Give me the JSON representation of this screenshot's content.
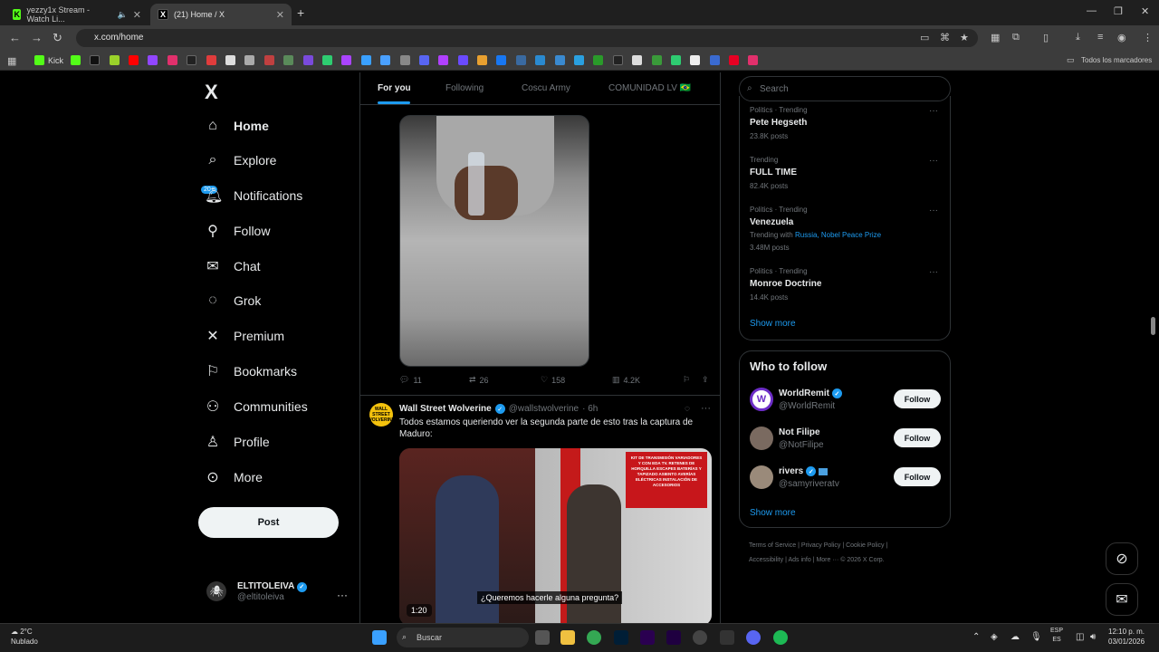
{
  "browser": {
    "tabs": [
      {
        "title": "yezzy1x Stream - Watch Li...",
        "favicon": "K",
        "favicon_color": "#53fc18"
      },
      {
        "title": "(21) Home / X",
        "favicon": "X",
        "favicon_color": "#000000"
      }
    ],
    "url": "x.com/home",
    "bookmark_label": "Kick",
    "all_bookmarks": "Todos los marcadores"
  },
  "nav": {
    "logo": "X",
    "items": [
      {
        "label": "Home",
        "icon": "home-icon"
      },
      {
        "label": "Explore",
        "icon": "search-icon"
      },
      {
        "label": "Notifications",
        "icon": "bell-icon"
      },
      {
        "label": "Follow",
        "icon": "person-plus-icon"
      },
      {
        "label": "Chat",
        "icon": "mail-icon"
      },
      {
        "label": "Grok",
        "icon": "grok-icon"
      },
      {
        "label": "Premium",
        "icon": "x-icon"
      },
      {
        "label": "Bookmarks",
        "icon": "bookmark-icon"
      },
      {
        "label": "Communities",
        "icon": "people-icon"
      },
      {
        "label": "Profile",
        "icon": "person-icon"
      },
      {
        "label": "More",
        "icon": "more-circle-icon"
      }
    ],
    "notif_badge": "20+",
    "post_label": "Post",
    "profile_name": "ELTITOLEIVA",
    "profile_handle": "@eltitoleiva"
  },
  "feed": {
    "tabs": [
      "For you",
      "Following",
      "Coscu Army",
      "COMUNIDAD LV 🇧🇷"
    ],
    "tweet1_actions": {
      "replies": "11",
      "reposts": "26",
      "likes": "158",
      "views": "4.2K"
    },
    "tweet2": {
      "name": "Wall Street Wolverine",
      "handle": "@wallstwolverine",
      "time": "· 6h",
      "text": "Todos estamos queriendo ver la segunda parte de esto tras la captura de Maduro:",
      "video_duration": "1:20",
      "subtitle": "¿Queremos hacerle alguna pregunta?",
      "sign_text": "KIT DE TRANSMISIÓN VARIADORES Y CON EDA TV. RETENES DE HORQUILLA ESCAPES BATERÍAS Y TAPIZADO ASIENTO AVERÍAS ELÉCTRICAS INSTALACIÓN DE ACCESORIOS",
      "avatar_text": "WALL STREET WOLVERINE"
    }
  },
  "sidebar": {
    "search_placeholder": "Search",
    "trends": [
      {
        "category": "Politics · Trending",
        "name": "Pete Hegseth",
        "posts": "23.8K posts"
      },
      {
        "category": "Trending",
        "name": "FULL TIME",
        "posts": "82.4K posts"
      },
      {
        "category": "Politics · Trending",
        "name": "Venezuela",
        "with_label": "Trending with",
        "with_links": "Russia, Nobel Peace Prize",
        "posts": "3.48M posts"
      },
      {
        "category": "Politics · Trending",
        "name": "Monroe Doctrine",
        "posts": "14.4K posts"
      }
    ],
    "show_more": "Show more",
    "who_to_follow_title": "Who to follow",
    "who_to_follow": [
      {
        "name": "WorldRemit",
        "handle": "@WorldRemit",
        "button": "Follow",
        "avatar_color": "#6c2dc7"
      },
      {
        "name": "Not Filipe",
        "handle": "@NotFilipe",
        "button": "Follow",
        "avatar_color": "#7a6a60"
      },
      {
        "name": "rivers",
        "handle": "@samyriveratv",
        "button": "Follow",
        "avatar_color": "#9a8a7a"
      }
    ],
    "footer_line1": "Terms of Service  |  Privacy Policy  |  Cookie Policy  |",
    "footer_line2": "Accessibility  |  Ads info  |  More ···  © 2026 X Corp."
  },
  "taskbar": {
    "temp": "2°C",
    "weather": "Nublado",
    "search": "Buscar",
    "lang1": "ESP",
    "lang2": "ES",
    "time": "12:10 p. m.",
    "date": "03/01/2026"
  }
}
